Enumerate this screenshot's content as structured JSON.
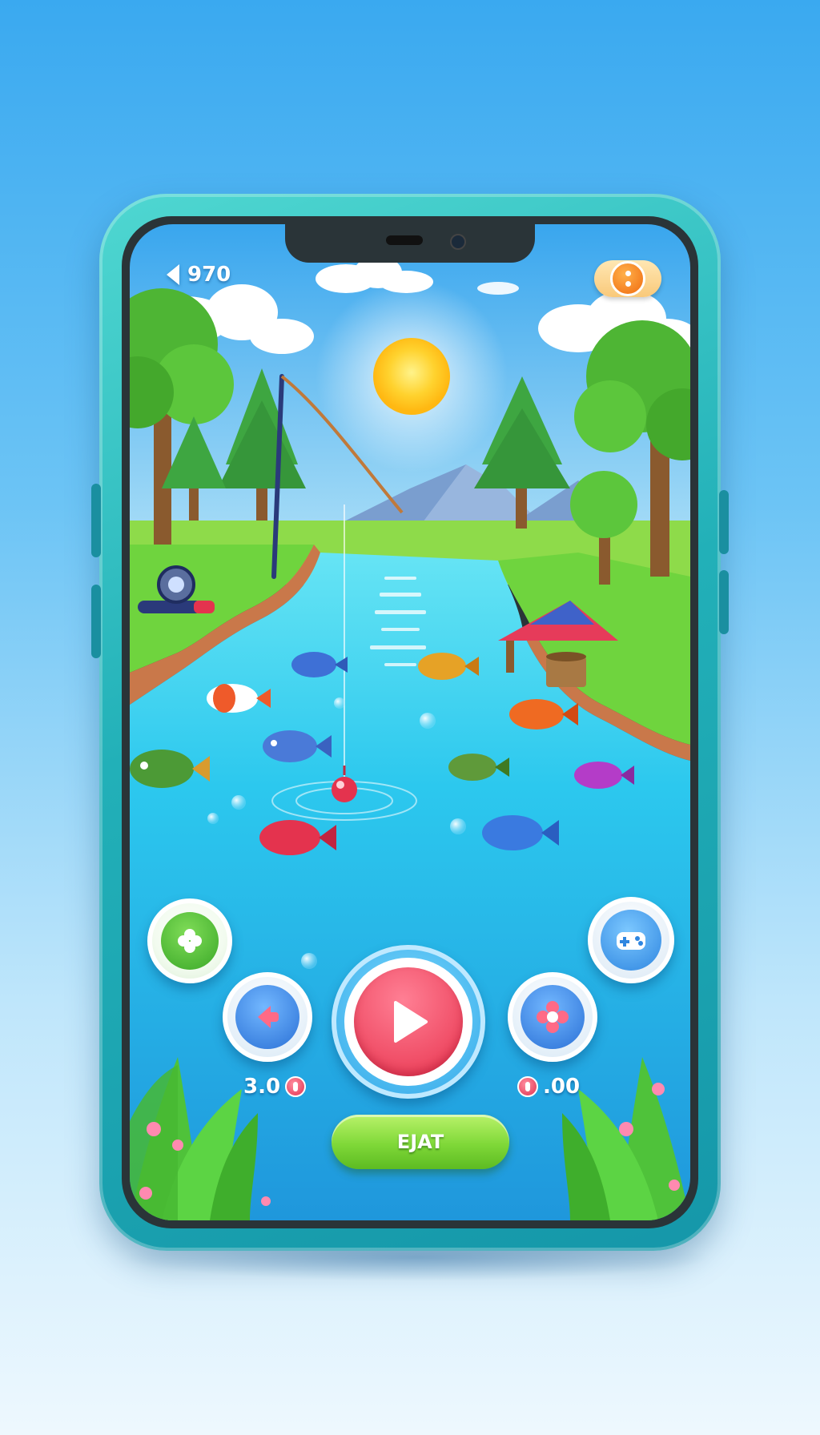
{
  "hud": {
    "score": "970",
    "menu_icon": "menu-dots-icon",
    "back_icon": "back-arrow-icon"
  },
  "controls": {
    "play_icon": "play-icon",
    "left_icon": "left-arrow-icon",
    "right_icon": "flower-icon",
    "top_left_icon": "clover-icon",
    "top_right_icon": "gamepad-icon",
    "left_value": "3.0",
    "right_value": ".00",
    "action_label": "EJAT"
  },
  "colors": {
    "sky": "#3aa9f0",
    "water": "#2cc8ee",
    "grass": "#6fd43e",
    "phone_frame": "#22b0b8",
    "play_button": "#e8334e",
    "action_button": "#7fd838"
  }
}
